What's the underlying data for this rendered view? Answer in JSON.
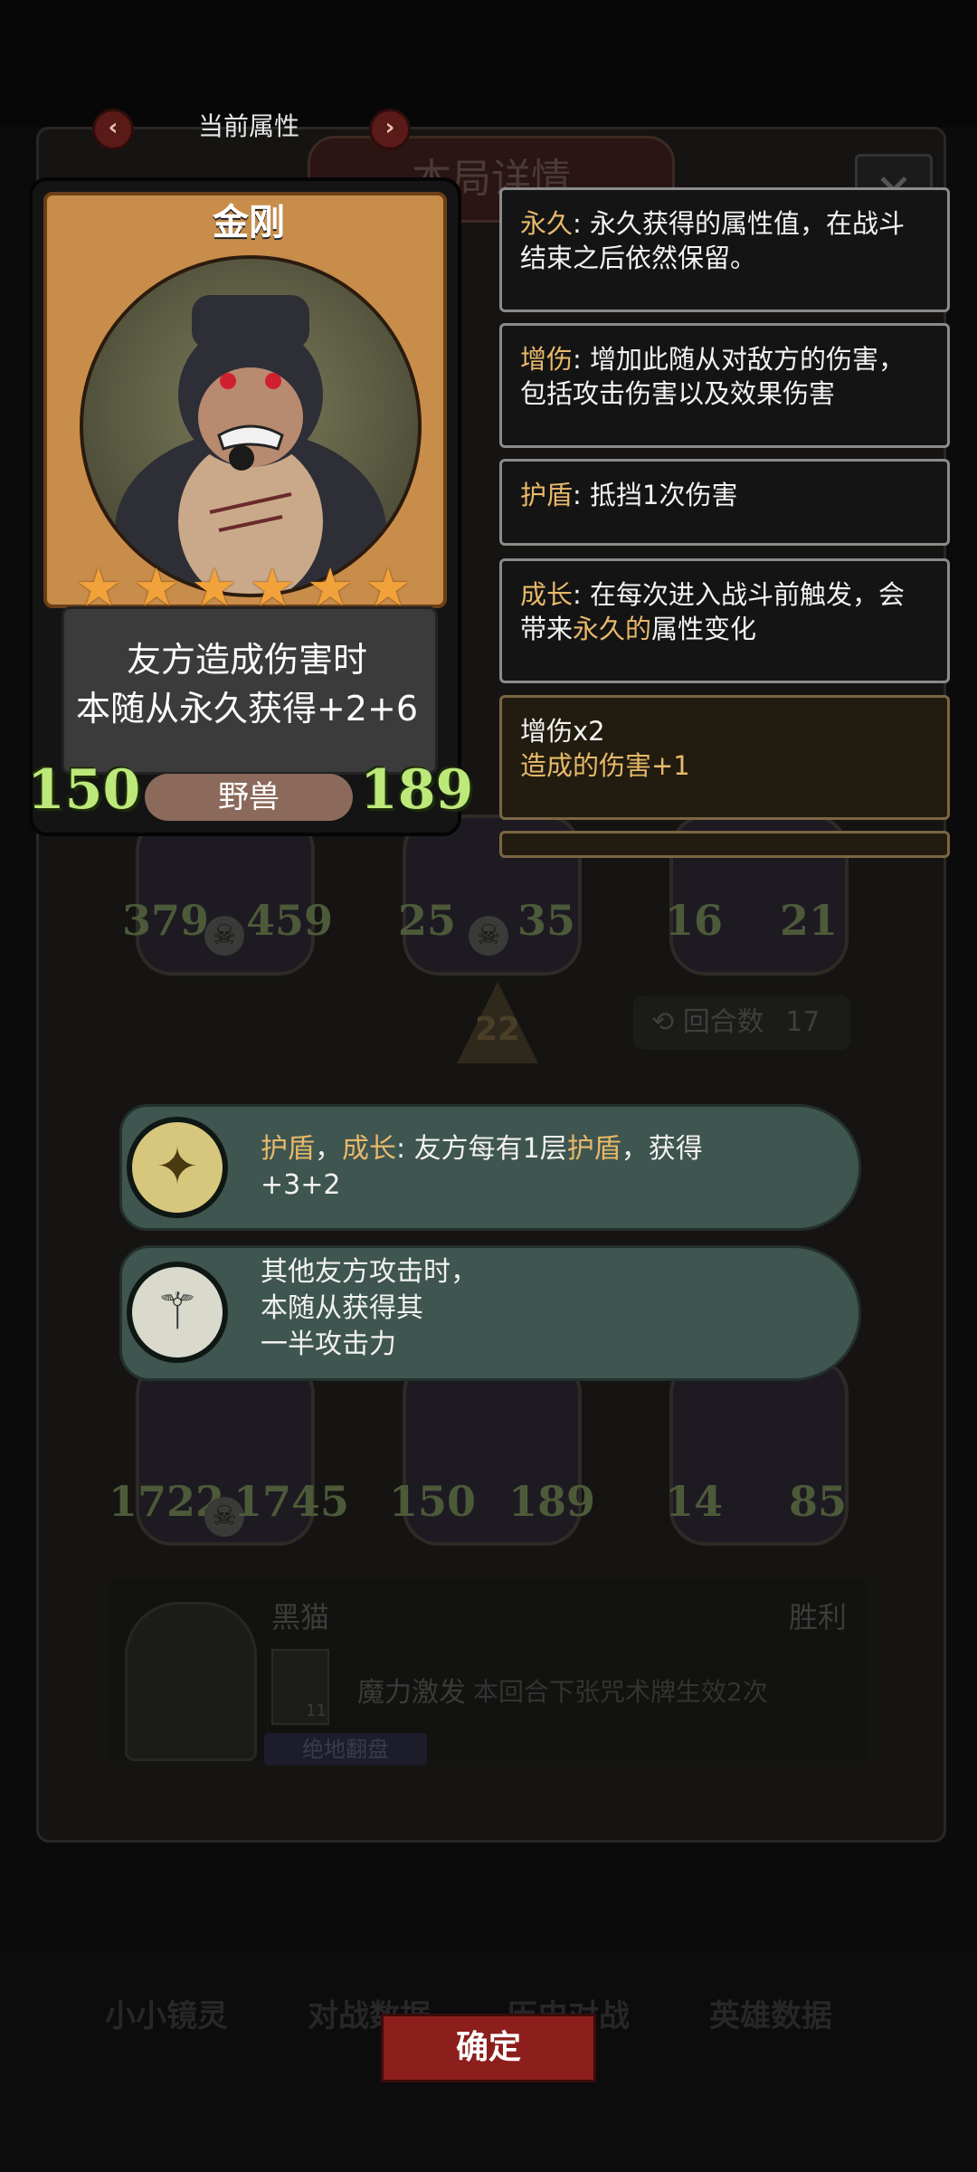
{
  "header": {
    "page_label": "当前属性",
    "prev_icon": "chevron-left-icon",
    "next_icon": "chevron-right-icon"
  },
  "background": {
    "panel_title": "本局详情",
    "row1_stats": [
      [
        "379",
        "459"
      ],
      [
        "25",
        "35"
      ],
      [
        "16",
        "21"
      ]
    ],
    "level": "22",
    "round_label": "回合数",
    "round_value": "17",
    "row2_stats": [
      [
        "1722",
        "1745"
      ],
      [
        "150",
        "189"
      ],
      [
        "14",
        "85"
      ]
    ],
    "log": {
      "opponent": "黑猫",
      "result": "胜利",
      "spell_name": "魔力激发",
      "spell_desc": "本回合下张咒术牌生效2次",
      "spell_cost": "11",
      "tag": "绝地翻盘"
    },
    "bottom_tabs": [
      "小小镜灵",
      "对战数据",
      "历史对战",
      "英雄数据"
    ]
  },
  "card": {
    "name": "金刚",
    "stars": 6,
    "desc_line1": "友方造成伤害时",
    "desc_line2": "本随从永久获得+2+6",
    "attack": "150",
    "health": "189",
    "tribe": "野兽"
  },
  "keywords": [
    {
      "term": "永久",
      "text": ": 永久获得的属性值，在战斗结束之后依然保留。"
    },
    {
      "term": "增伤",
      "text": ": 增加此随从对敌方的伤害，包括攻击伤害以及效果伤害"
    },
    {
      "term": "护盾",
      "text": ": 抵挡1次伤害"
    },
    {
      "term": "成长",
      "text_a": ": 在每次进入战斗前触发，会带来",
      "highlight": "永久的",
      "text_b": "属性变化"
    }
  ],
  "buff": {
    "title": "增伤x2",
    "text": "造成的伤害+1"
  },
  "abilities": [
    {
      "k1": "护盾",
      "sep": "，",
      "k2": "成长",
      "colon": ": 友方每有1层",
      "k3": "护盾",
      "tail": "，获得+3+2",
      "icon": "sword-light-icon"
    },
    {
      "line1": "其他友方攻击时，",
      "line2": "本随从获得其",
      "line3": "一半攻击力",
      "icon": "staff-icon"
    }
  ],
  "confirm_label": "确定"
}
